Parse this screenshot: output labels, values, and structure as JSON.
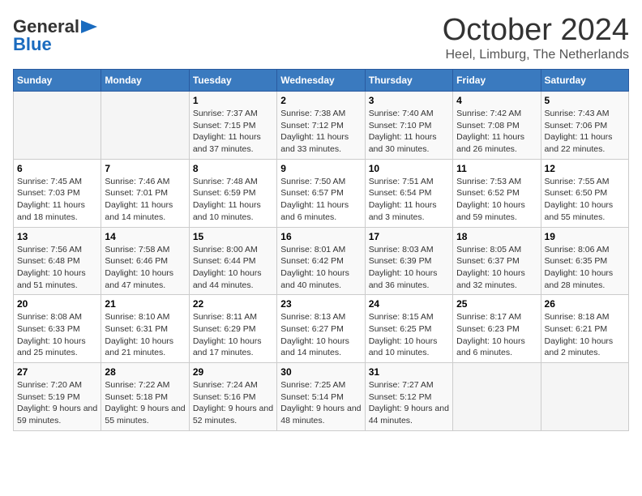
{
  "header": {
    "logo_line1": "General",
    "logo_line2": "Blue",
    "month": "October 2024",
    "location": "Heel, Limburg, The Netherlands"
  },
  "weekdays": [
    "Sunday",
    "Monday",
    "Tuesday",
    "Wednesday",
    "Thursday",
    "Friday",
    "Saturday"
  ],
  "weeks": [
    [
      {
        "day": "",
        "info": ""
      },
      {
        "day": "",
        "info": ""
      },
      {
        "day": "1",
        "info": "Sunrise: 7:37 AM\nSunset: 7:15 PM\nDaylight: 11 hours and 37 minutes."
      },
      {
        "day": "2",
        "info": "Sunrise: 7:38 AM\nSunset: 7:12 PM\nDaylight: 11 hours and 33 minutes."
      },
      {
        "day": "3",
        "info": "Sunrise: 7:40 AM\nSunset: 7:10 PM\nDaylight: 11 hours and 30 minutes."
      },
      {
        "day": "4",
        "info": "Sunrise: 7:42 AM\nSunset: 7:08 PM\nDaylight: 11 hours and 26 minutes."
      },
      {
        "day": "5",
        "info": "Sunrise: 7:43 AM\nSunset: 7:06 PM\nDaylight: 11 hours and 22 minutes."
      }
    ],
    [
      {
        "day": "6",
        "info": "Sunrise: 7:45 AM\nSunset: 7:03 PM\nDaylight: 11 hours and 18 minutes."
      },
      {
        "day": "7",
        "info": "Sunrise: 7:46 AM\nSunset: 7:01 PM\nDaylight: 11 hours and 14 minutes."
      },
      {
        "day": "8",
        "info": "Sunrise: 7:48 AM\nSunset: 6:59 PM\nDaylight: 11 hours and 10 minutes."
      },
      {
        "day": "9",
        "info": "Sunrise: 7:50 AM\nSunset: 6:57 PM\nDaylight: 11 hours and 6 minutes."
      },
      {
        "day": "10",
        "info": "Sunrise: 7:51 AM\nSunset: 6:54 PM\nDaylight: 11 hours and 3 minutes."
      },
      {
        "day": "11",
        "info": "Sunrise: 7:53 AM\nSunset: 6:52 PM\nDaylight: 10 hours and 59 minutes."
      },
      {
        "day": "12",
        "info": "Sunrise: 7:55 AM\nSunset: 6:50 PM\nDaylight: 10 hours and 55 minutes."
      }
    ],
    [
      {
        "day": "13",
        "info": "Sunrise: 7:56 AM\nSunset: 6:48 PM\nDaylight: 10 hours and 51 minutes."
      },
      {
        "day": "14",
        "info": "Sunrise: 7:58 AM\nSunset: 6:46 PM\nDaylight: 10 hours and 47 minutes."
      },
      {
        "day": "15",
        "info": "Sunrise: 8:00 AM\nSunset: 6:44 PM\nDaylight: 10 hours and 44 minutes."
      },
      {
        "day": "16",
        "info": "Sunrise: 8:01 AM\nSunset: 6:42 PM\nDaylight: 10 hours and 40 minutes."
      },
      {
        "day": "17",
        "info": "Sunrise: 8:03 AM\nSunset: 6:39 PM\nDaylight: 10 hours and 36 minutes."
      },
      {
        "day": "18",
        "info": "Sunrise: 8:05 AM\nSunset: 6:37 PM\nDaylight: 10 hours and 32 minutes."
      },
      {
        "day": "19",
        "info": "Sunrise: 8:06 AM\nSunset: 6:35 PM\nDaylight: 10 hours and 28 minutes."
      }
    ],
    [
      {
        "day": "20",
        "info": "Sunrise: 8:08 AM\nSunset: 6:33 PM\nDaylight: 10 hours and 25 minutes."
      },
      {
        "day": "21",
        "info": "Sunrise: 8:10 AM\nSunset: 6:31 PM\nDaylight: 10 hours and 21 minutes."
      },
      {
        "day": "22",
        "info": "Sunrise: 8:11 AM\nSunset: 6:29 PM\nDaylight: 10 hours and 17 minutes."
      },
      {
        "day": "23",
        "info": "Sunrise: 8:13 AM\nSunset: 6:27 PM\nDaylight: 10 hours and 14 minutes."
      },
      {
        "day": "24",
        "info": "Sunrise: 8:15 AM\nSunset: 6:25 PM\nDaylight: 10 hours and 10 minutes."
      },
      {
        "day": "25",
        "info": "Sunrise: 8:17 AM\nSunset: 6:23 PM\nDaylight: 10 hours and 6 minutes."
      },
      {
        "day": "26",
        "info": "Sunrise: 8:18 AM\nSunset: 6:21 PM\nDaylight: 10 hours and 2 minutes."
      }
    ],
    [
      {
        "day": "27",
        "info": "Sunrise: 7:20 AM\nSunset: 5:19 PM\nDaylight: 9 hours and 59 minutes."
      },
      {
        "day": "28",
        "info": "Sunrise: 7:22 AM\nSunset: 5:18 PM\nDaylight: 9 hours and 55 minutes."
      },
      {
        "day": "29",
        "info": "Sunrise: 7:24 AM\nSunset: 5:16 PM\nDaylight: 9 hours and 52 minutes."
      },
      {
        "day": "30",
        "info": "Sunrise: 7:25 AM\nSunset: 5:14 PM\nDaylight: 9 hours and 48 minutes."
      },
      {
        "day": "31",
        "info": "Sunrise: 7:27 AM\nSunset: 5:12 PM\nDaylight: 9 hours and 44 minutes."
      },
      {
        "day": "",
        "info": ""
      },
      {
        "day": "",
        "info": ""
      }
    ]
  ]
}
